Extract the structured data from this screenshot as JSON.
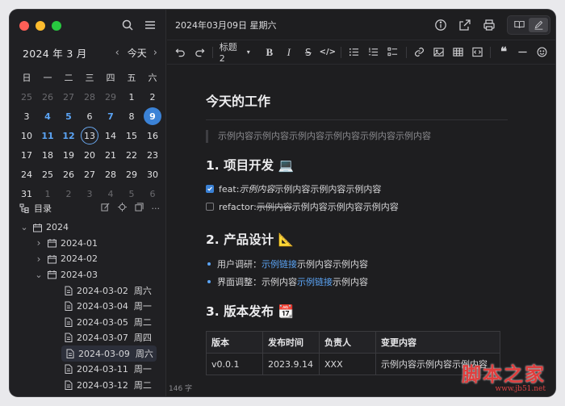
{
  "calendar": {
    "title": "2024 年 3 月",
    "prev": "‹",
    "next": "›",
    "today": "今天",
    "weekdays": [
      "日",
      "一",
      "二",
      "三",
      "四",
      "五",
      "六"
    ],
    "days": [
      {
        "d": "25",
        "k": "other"
      },
      {
        "d": "26",
        "k": "other"
      },
      {
        "d": "27",
        "k": "other"
      },
      {
        "d": "28",
        "k": "other"
      },
      {
        "d": "29",
        "k": "other"
      },
      {
        "d": "1",
        "k": ""
      },
      {
        "d": "2",
        "k": ""
      },
      {
        "d": "3",
        "k": ""
      },
      {
        "d": "4",
        "k": "blue"
      },
      {
        "d": "5",
        "k": "blue"
      },
      {
        "d": "6",
        "k": ""
      },
      {
        "d": "7",
        "k": "blue"
      },
      {
        "d": "8",
        "k": ""
      },
      {
        "d": "9",
        "k": "sel"
      },
      {
        "d": "10",
        "k": ""
      },
      {
        "d": "11",
        "k": "blue"
      },
      {
        "d": "12",
        "k": "blue"
      },
      {
        "d": "13",
        "k": "ring"
      },
      {
        "d": "14",
        "k": ""
      },
      {
        "d": "15",
        "k": ""
      },
      {
        "d": "16",
        "k": ""
      },
      {
        "d": "17",
        "k": ""
      },
      {
        "d": "18",
        "k": ""
      },
      {
        "d": "19",
        "k": ""
      },
      {
        "d": "20",
        "k": ""
      },
      {
        "d": "21",
        "k": ""
      },
      {
        "d": "22",
        "k": ""
      },
      {
        "d": "23",
        "k": ""
      },
      {
        "d": "24",
        "k": ""
      },
      {
        "d": "25",
        "k": ""
      },
      {
        "d": "26",
        "k": ""
      },
      {
        "d": "27",
        "k": ""
      },
      {
        "d": "28",
        "k": ""
      },
      {
        "d": "29",
        "k": ""
      },
      {
        "d": "30",
        "k": ""
      },
      {
        "d": "31",
        "k": ""
      },
      {
        "d": "1",
        "k": "other"
      },
      {
        "d": "2",
        "k": "other"
      },
      {
        "d": "3",
        "k": "other"
      },
      {
        "d": "4",
        "k": "other"
      },
      {
        "d": "5",
        "k": "other"
      },
      {
        "d": "6",
        "k": "other"
      }
    ]
  },
  "tree": {
    "title": "目录",
    "items": [
      {
        "label": "2024",
        "type": "folder",
        "depth": 0,
        "expanded": true
      },
      {
        "label": "2024-01",
        "type": "folder",
        "depth": 1,
        "expanded": false
      },
      {
        "label": "2024-02",
        "type": "folder",
        "depth": 1,
        "expanded": false
      },
      {
        "label": "2024-03",
        "type": "folder",
        "depth": 1,
        "expanded": true
      },
      {
        "label": "2024-03-02  周六",
        "type": "file",
        "depth": 2
      },
      {
        "label": "2024-03-04  周一",
        "type": "file",
        "depth": 2
      },
      {
        "label": "2024-03-05  周二",
        "type": "file",
        "depth": 2
      },
      {
        "label": "2024-03-07  周四",
        "type": "file",
        "depth": 2
      },
      {
        "label": "2024-03-09  周六",
        "type": "file",
        "depth": 2,
        "active": true
      },
      {
        "label": "2024-03-11  周一",
        "type": "file",
        "depth": 2
      },
      {
        "label": "2024-03-12  周二",
        "type": "file",
        "depth": 2
      }
    ]
  },
  "header": {
    "date_title": "2024年03月09日 星期六"
  },
  "toolbar": {
    "heading_select": "标题 2"
  },
  "doc": {
    "title": "今天的工作",
    "quote": "示例内容示例内容示例内容示例内容示例内容示例内容",
    "sections": {
      "s1": "1. 项目开发 💻",
      "s2": "2. 产品设计 📐",
      "s3": "3. 版本发布 📆"
    },
    "tasks": {
      "t1_prefix": "feat: ",
      "t1_em": "示例内容",
      "t1_rest": "示例内容示例内容示例内容",
      "t2_prefix": "refactor: ",
      "t2_strike": "示例内容",
      "t2_rest": "示例内容示例内容示例内容"
    },
    "bullets": {
      "b1_prefix": "用户调研：",
      "b1_link": "示例链接",
      "b1_rest": "示例内容示例内容",
      "b2_prefix": "界面调整：示例内容",
      "b2_link": "示例链接",
      "b2_rest": "示例内容"
    },
    "table": {
      "headers": [
        "版本",
        "发布时间",
        "负责人",
        "变更内容"
      ],
      "rows": [
        [
          "v0.0.1",
          "2023.9.14",
          "XXX",
          "示例内容示例内容示例内容"
        ]
      ]
    }
  },
  "status": {
    "word_count": "146 字"
  },
  "watermark": {
    "big": "脚本之家",
    "small": "www.jb51.net"
  },
  "colors": {
    "accent": "#3b82d6",
    "link": "#5ba4f5",
    "bg": "#1e1e20"
  }
}
